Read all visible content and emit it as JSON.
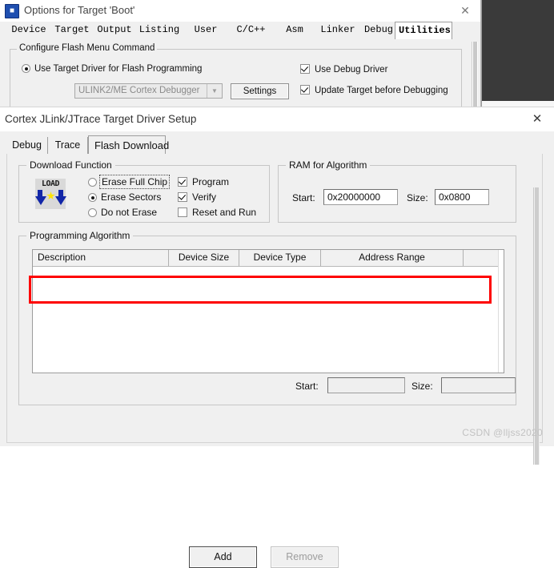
{
  "background": {
    "editor_area": "dark-editor-pane"
  },
  "options_dialog": {
    "title": "Options for Target 'Boot'",
    "icon": "keil-uvision-icon",
    "close_label": "✕",
    "tabs": [
      {
        "label": "Device",
        "selected": false
      },
      {
        "label": "Target",
        "selected": false
      },
      {
        "label": "Output",
        "selected": false
      },
      {
        "label": "Listing",
        "selected": false
      },
      {
        "label": "User",
        "selected": false
      },
      {
        "label": "C/C++",
        "selected": false
      },
      {
        "label": "Asm",
        "selected": false
      },
      {
        "label": "Linker",
        "selected": false
      },
      {
        "label": "Debug",
        "selected": false
      },
      {
        "label": "Utilities",
        "selected": true
      }
    ],
    "flash_menu_group": {
      "legend": "Configure Flash Menu Command",
      "use_target_driver": {
        "label": "Use Target Driver for Flash Programming",
        "checked": true
      },
      "debugger_combo": {
        "value": "ULINK2/ME Cortex Debugger",
        "enabled": false,
        "arrow": "▼"
      },
      "settings_button": "Settings",
      "use_debug_driver": {
        "label": "Use Debug Driver",
        "checked": true
      },
      "update_target": {
        "label": "Update Target before Debugging",
        "checked": true
      }
    }
  },
  "jlink_dialog": {
    "title": "Cortex JLink/JTrace Target Driver Setup",
    "close_label": "✕",
    "tabs": [
      {
        "label": "Debug",
        "selected": false
      },
      {
        "label": "Trace",
        "selected": false
      },
      {
        "label": "Flash Download",
        "selected": true
      }
    ],
    "download_function": {
      "legend": "Download Function",
      "icon": "load-icon",
      "icon_text": "LOAD",
      "radios": [
        {
          "label": "Erase Full Chip",
          "checked": false,
          "focused": true
        },
        {
          "label": "Erase Sectors",
          "checked": true,
          "focused": false
        },
        {
          "label": "Do not Erase",
          "checked": false,
          "focused": false
        }
      ],
      "checkboxes": [
        {
          "label": "Program",
          "checked": true
        },
        {
          "label": "Verify",
          "checked": true
        },
        {
          "label": "Reset and Run",
          "checked": false
        }
      ]
    },
    "ram_for_algorithm": {
      "legend": "RAM for Algorithm",
      "start_label": "Start:",
      "start_value": "0x20000000",
      "size_label": "Size:",
      "size_value": "0x0800"
    },
    "programming_algorithm": {
      "legend": "Programming Algorithm",
      "columns": [
        "Description",
        "Device Size",
        "Device Type",
        "Address Range",
        ""
      ],
      "rows": [],
      "empty_row_highlight_color": "#fe0000",
      "start_label": "Start:",
      "start_value": "",
      "size_label": "Size:",
      "size_value": ""
    },
    "buttons": {
      "add": "Add",
      "remove": "Remove",
      "remove_enabled": false
    }
  },
  "watermark": "CSDN @lljss2020"
}
